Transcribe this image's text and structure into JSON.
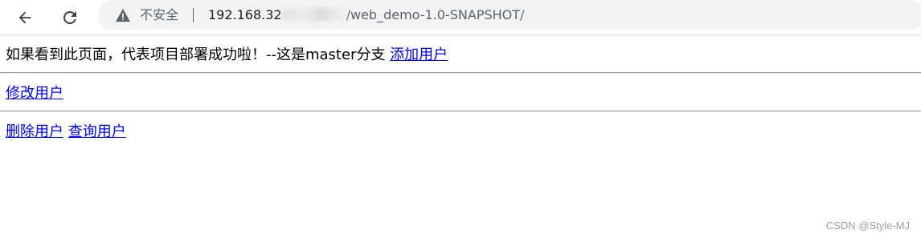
{
  "browser": {
    "security_label": "不安全",
    "url_host": "192.168.32",
    "url_path": "/web_demo-1.0-SNAPSHOT/"
  },
  "content": {
    "intro_text": "如果看到此页面，代表项目部署成功啦！--这是master分支 ",
    "add_user_link": "添加用户",
    "edit_user_link": "修改用户",
    "delete_user_link": "删除用户",
    "query_user_link": "查询用户"
  },
  "watermark": "CSDN @Style-MJ",
  "colors": {
    "link": "#0000ee",
    "omnibox_bg": "#f1f3f4"
  }
}
